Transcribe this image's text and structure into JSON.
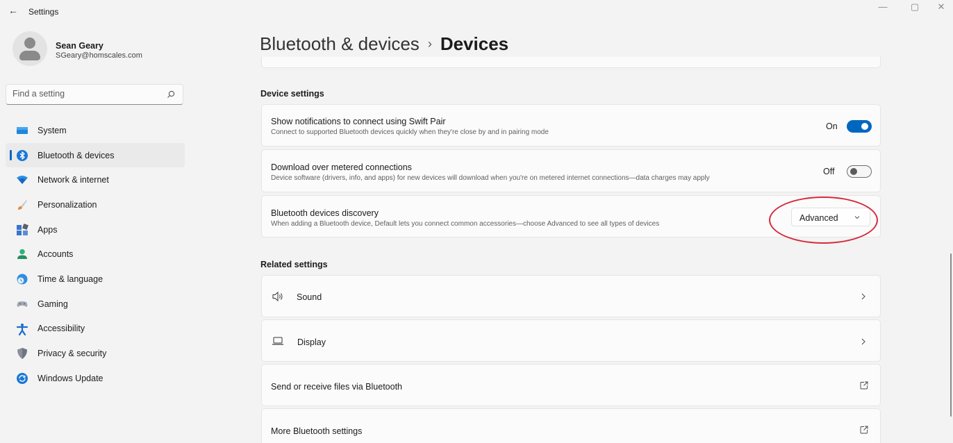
{
  "window": {
    "title": "Settings",
    "back_glyph": "←",
    "minimize_glyph": "—",
    "maximize_glyph": "▢",
    "close_glyph": "✕"
  },
  "profile": {
    "name": "Sean Geary",
    "email": "SGeary@homscales.com"
  },
  "search": {
    "placeholder": "Find a setting",
    "icon": "search-icon"
  },
  "sidebar": {
    "active_index": 1,
    "items": [
      {
        "label": "System",
        "icon": "system-icon"
      },
      {
        "label": "Bluetooth & devices",
        "icon": "bluetooth-icon"
      },
      {
        "label": "Network & internet",
        "icon": "network-icon"
      },
      {
        "label": "Personalization",
        "icon": "brush-icon"
      },
      {
        "label": "Apps",
        "icon": "apps-icon"
      },
      {
        "label": "Accounts",
        "icon": "accounts-icon"
      },
      {
        "label": "Time & language",
        "icon": "globe-clock-icon"
      },
      {
        "label": "Gaming",
        "icon": "gamepad-icon"
      },
      {
        "label": "Accessibility",
        "icon": "accessibility-icon"
      },
      {
        "label": "Privacy & security",
        "icon": "shield-icon"
      },
      {
        "label": "Windows Update",
        "icon": "update-icon"
      }
    ]
  },
  "breadcrumb": {
    "parent": "Bluetooth & devices",
    "separator": "›",
    "current": "Devices"
  },
  "device_settings": {
    "heading": "Device settings",
    "swift_pair": {
      "title": "Show notifications to connect using Swift Pair",
      "description": "Connect to supported Bluetooth devices quickly when they're close by and in pairing mode",
      "state_label": "On",
      "on": true
    },
    "metered": {
      "title": "Download over metered connections",
      "description": "Device software (drivers, info, and apps) for new devices will download when you're on metered internet connections—data charges may apply",
      "state_label": "Off",
      "on": false
    },
    "discovery": {
      "title": "Bluetooth devices discovery",
      "description": "When adding a Bluetooth device, Default lets you connect common accessories—choose Advanced to see all types of devices",
      "selected": "Advanced"
    }
  },
  "related_settings": {
    "heading": "Related settings",
    "items": [
      {
        "label": "Sound",
        "icon": "speaker-icon",
        "action": "chevron-right-icon"
      },
      {
        "label": "Display",
        "icon": "laptop-icon",
        "action": "chevron-right-icon"
      },
      {
        "label": "Send or receive files via Bluetooth",
        "action": "open-external-icon"
      },
      {
        "label": "More Bluetooth settings",
        "action": "open-external-icon"
      }
    ]
  },
  "colors": {
    "accent": "#0067c0",
    "annotation_ring": "#d5293b"
  }
}
